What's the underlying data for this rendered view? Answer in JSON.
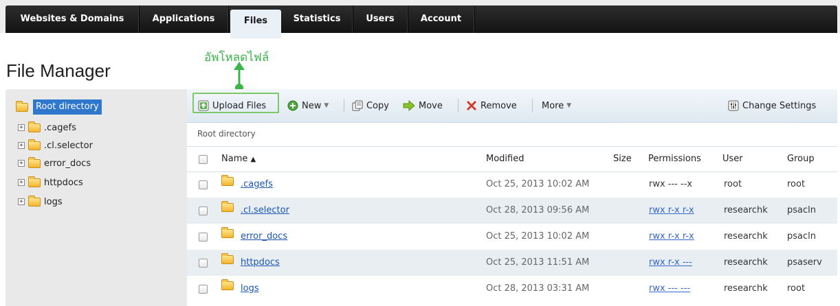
{
  "tabs": [
    "Websites & Domains",
    "Applications",
    "Files",
    "Statistics",
    "Users",
    "Account"
  ],
  "active_tab": "Files",
  "callout": "อัพโหลดไฟล์",
  "page_title": "File Manager",
  "tree": {
    "root": "Root directory",
    "items": [
      ".cagefs",
      ".cl.selector",
      "error_docs",
      "httpdocs",
      "logs"
    ],
    "expander": "+"
  },
  "toolbar": {
    "upload": "Upload Files",
    "new": "New",
    "copy": "Copy",
    "move": "Move",
    "remove": "Remove",
    "more": "More",
    "settings": "Change Settings"
  },
  "breadcrumb": "Root directory",
  "table": {
    "headers": {
      "name": "Name",
      "sort_indicator": "▲",
      "modified": "Modified",
      "size": "Size",
      "permissions": "Permissions",
      "user": "User",
      "group": "Group"
    },
    "rows": [
      {
        "name": ".cagefs",
        "modified": "Oct 25, 2013 10:02 AM",
        "size": "",
        "permissions": "rwx --- --x",
        "user": "root",
        "group": "root"
      },
      {
        "name": ".cl.selector",
        "modified": "Oct 28, 2013 09:56 AM",
        "size": "",
        "permissions": "rwx r-x r-x",
        "user": "researchk",
        "group": "psacln"
      },
      {
        "name": "error_docs",
        "modified": "Oct 25, 2013 10:02 AM",
        "size": "",
        "permissions": "rwx r-x r-x",
        "user": "researchk",
        "group": "psacln"
      },
      {
        "name": "httpdocs",
        "modified": "Oct 25, 2013 11:51 AM",
        "size": "",
        "permissions": "rwx r-x ---",
        "user": "researchk",
        "group": "psaserv"
      },
      {
        "name": "logs",
        "modified": "Oct 28, 2013 03:31 AM",
        "size": "",
        "permissions": "rwx --- ---",
        "user": "researchk",
        "group": "root"
      }
    ]
  },
  "colors": {
    "accent": "#2e77cc",
    "callout": "#3bb54a",
    "link": "#1a55b3",
    "row_alt": "#e9eef2"
  }
}
